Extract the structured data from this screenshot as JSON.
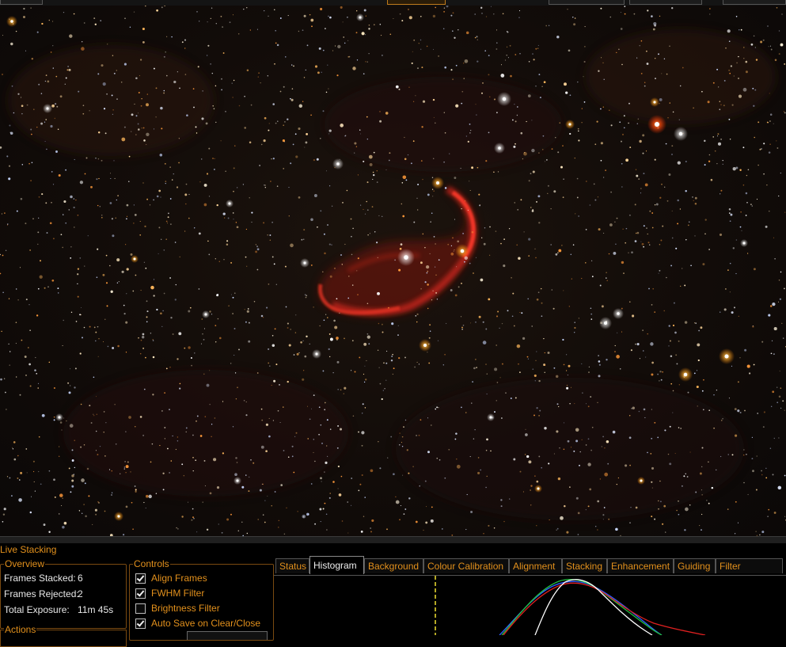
{
  "panel": {
    "title": "Live Stacking"
  },
  "overview": {
    "title": "Overview",
    "frames_stacked_label": "Frames Stacked:",
    "frames_stacked_value": "6",
    "frames_rejected_label": "Frames Rejected:",
    "frames_rejected_value": "2",
    "total_exposure_label": "Total Exposure:",
    "total_exposure_value": "11m 45s"
  },
  "controls": {
    "title": "Controls",
    "items": [
      {
        "label": "Align Frames",
        "checked": true
      },
      {
        "label": "FWHM Filter",
        "checked": true
      },
      {
        "label": "Brightness Filter",
        "checked": false
      },
      {
        "label": "Auto Save on Clear/Close",
        "checked": true
      }
    ]
  },
  "actions": {
    "title": "Actions"
  },
  "tabs": [
    {
      "label": "Status",
      "active": false
    },
    {
      "label": "Histogram",
      "active": true
    },
    {
      "label": "Background",
      "active": false
    },
    {
      "label": "Colour Calibration",
      "active": false
    },
    {
      "label": "Alignment",
      "active": false
    },
    {
      "label": "Stacking",
      "active": false
    },
    {
      "label": "Enhancement",
      "active": false
    },
    {
      "label": "Guiding",
      "active": false
    },
    {
      "label": "Filter (FWHM)",
      "active": false
    }
  ],
  "colors": {
    "accent_orange": "#e2901c",
    "nebula_red": "#c8261e",
    "hist_red": "#e02020",
    "hist_green": "#20c040",
    "hist_blue": "#3060ff",
    "hist_luminance": "#ffffff",
    "marker_yellow": "#f0e030"
  }
}
